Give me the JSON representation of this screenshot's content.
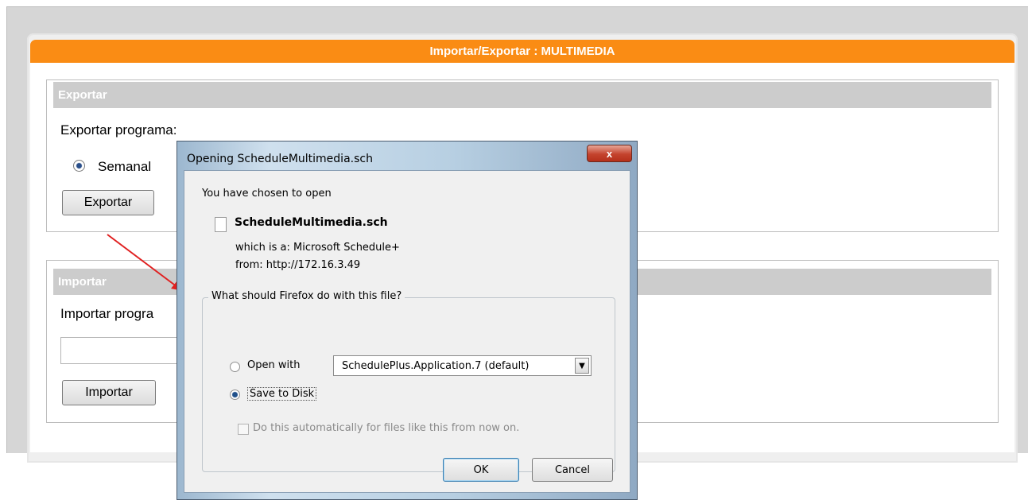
{
  "panel": {
    "title": "Importar/Exportar : MULTIMEDIA"
  },
  "export_section": {
    "heading": "Exportar",
    "label": "Exportar programa:",
    "radio_label": "Semanal",
    "button_label": "Exportar"
  },
  "import_section": {
    "heading": "Importar",
    "label": "Importar progra",
    "button_label": "Importar"
  },
  "dialog": {
    "title": "Opening ScheduleMultimedia.sch",
    "close_label": "x",
    "intro": "You have chosen to open",
    "file_name": "ScheduleMultimedia.sch",
    "file_type": "which is a:  Microsoft Schedule+",
    "file_source": "from:  http://172.16.3.49",
    "question": "What should Firefox do with this file?",
    "open_with_label": "Open with",
    "open_with_value": "SchedulePlus.Application.7 (default)",
    "save_label": "Save to Disk",
    "auto_label": "Do this automatically for files like this from now on.",
    "ok_label": "OK",
    "cancel_label": "Cancel"
  },
  "colors": {
    "title_bar": "#fa8c14",
    "section_head": "#cccccc",
    "annotation_arrow": "#e02020"
  }
}
